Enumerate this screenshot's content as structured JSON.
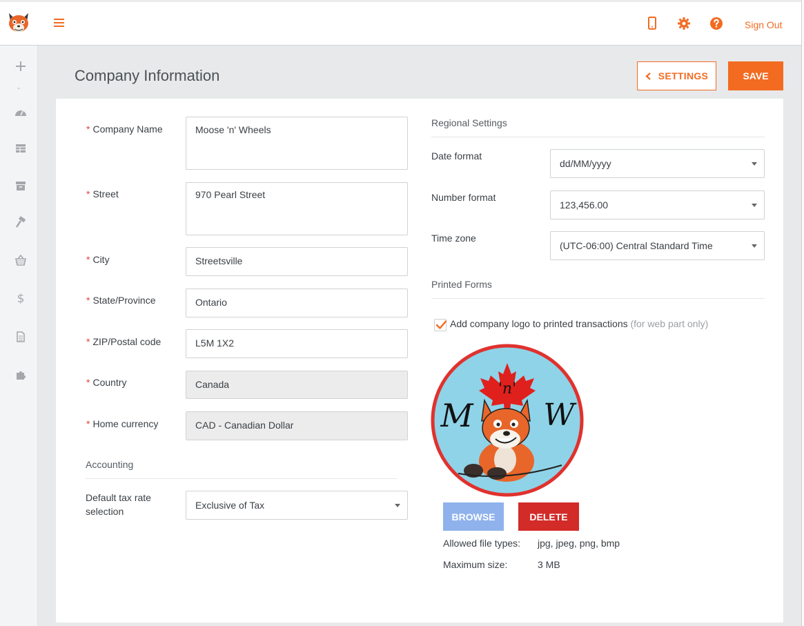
{
  "app": {
    "sign_out_label": "Sign Out"
  },
  "topbar": {
    "icons": [
      "mobile-icon",
      "gear-icon",
      "help-icon"
    ]
  },
  "sidebar": {
    "icons": [
      "plus-icon",
      "dashboard-icon",
      "table-icon",
      "archive-icon",
      "hammer-icon",
      "basket-icon",
      "dollar-icon",
      "document-icon",
      "puzzle-icon"
    ],
    "dash": "-"
  },
  "header": {
    "title": "Company Information",
    "settings_label": "SETTINGS",
    "save_label": "SAVE"
  },
  "company": {
    "name_label": "Company Name",
    "name_value": "Moose 'n' Wheels",
    "street_label": "Street",
    "street_value": "970 Pearl Street",
    "city_label": "City",
    "city_value": "Streetsville",
    "state_label": "State/Province",
    "state_value": "Ontario",
    "zip_label": "ZIP/Postal code",
    "zip_value": "L5M 1X2",
    "country_label": "Country",
    "country_value": "Canada",
    "currency_label": "Home currency",
    "currency_value": "CAD - Canadian Dollar",
    "required_mark": "*"
  },
  "accounting": {
    "title": "Accounting",
    "tax_label_line1": "Default tax rate",
    "tax_label_line2": "selection",
    "tax_value": "Exclusive of Tax"
  },
  "regional": {
    "title": "Regional Settings",
    "date_label": "Date format",
    "date_value": "dd/MM/yyyy",
    "number_label": "Number format",
    "number_value": "123,456.00",
    "timezone_label": "Time zone",
    "timezone_value": "(UTC-06:00) Central Standard Time"
  },
  "printed": {
    "title": "Printed Forms",
    "checkbox_label": "Add company logo to printed transactions",
    "checkbox_note": "(for web part only)",
    "checked": true,
    "logo_text": "'n'",
    "logo_m": "M",
    "logo_w": "W",
    "browse_label": "BROWSE",
    "delete_label": "DELETE",
    "allowed_label": "Allowed file types:",
    "allowed_value": "jpg, jpeg, png, bmp",
    "max_label": "Maximum size:",
    "max_value": "3 MB"
  },
  "colors": {
    "accent": "#f26b21",
    "required": "#e0443a",
    "browse": "#8fb2ec",
    "delete": "#d22b28"
  }
}
